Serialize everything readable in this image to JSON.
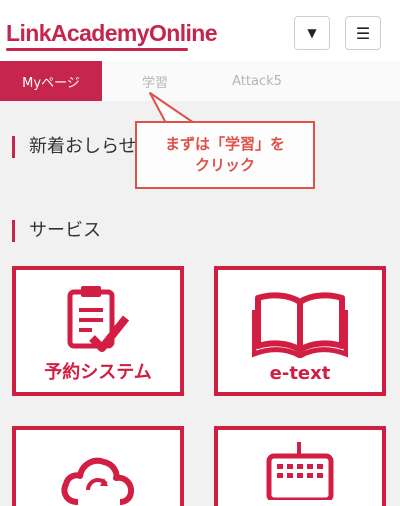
{
  "header": {
    "logo_text": "LinkAcademyOnline",
    "dropdown_glyph": "▼",
    "menu_glyph": "☰"
  },
  "tabs": [
    {
      "label": "Myページ",
      "active": true
    },
    {
      "label": "学習",
      "active": false
    },
    {
      "label": "Attack5",
      "active": false
    }
  ],
  "sections": {
    "news_title": "新着おしらせ",
    "services_title": "サービス"
  },
  "services": [
    {
      "label": "予約システム",
      "icon": "clipboard-check-icon"
    },
    {
      "label": "e-text",
      "icon": "open-book-icon"
    },
    {
      "label": "",
      "icon": "cloud-sync-icon"
    },
    {
      "label": "",
      "icon": "keyboard-icon"
    }
  ],
  "callout": {
    "line1": "まずは「学習」を",
    "line2": "クリック"
  },
  "colors": {
    "brand": "#c6264e",
    "card_red": "#d11e42",
    "callout": "#e0514a"
  }
}
